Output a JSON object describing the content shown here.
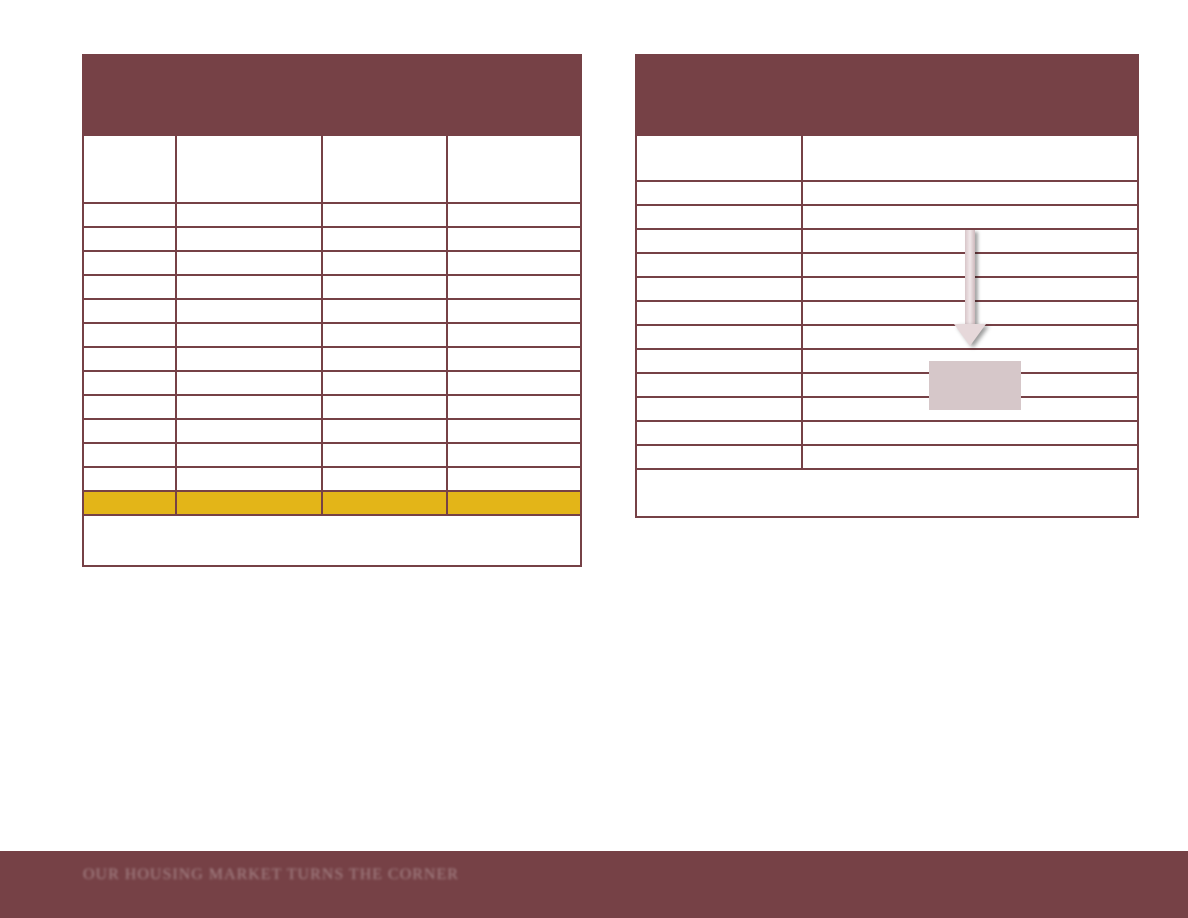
{
  "colors": {
    "primary": "#764146",
    "highlight": "#e3b518",
    "callout": "#d6c7c9",
    "background": "#ffffff"
  },
  "left_table": {
    "body_row_count": 12,
    "has_highlight_total_row": true
  },
  "right_table": {
    "body_row_count": 12
  },
  "callout": {
    "icon": "down-arrow-icon"
  },
  "footer": {
    "title": "OUR HOUSING MARKET TURNS THE CORNER"
  }
}
